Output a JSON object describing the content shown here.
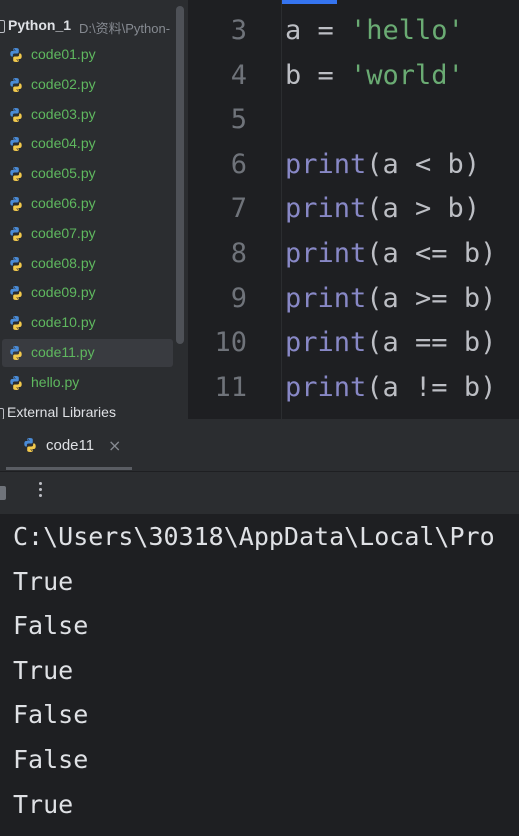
{
  "project": {
    "name": "Python_1",
    "path": "D:\\资料\\Python-",
    "files": [
      {
        "label": "code01.py"
      },
      {
        "label": "code02.py"
      },
      {
        "label": "code03.py"
      },
      {
        "label": "code04.py"
      },
      {
        "label": "code05.py"
      },
      {
        "label": "code06.py"
      },
      {
        "label": "code07.py"
      },
      {
        "label": "code08.py"
      },
      {
        "label": "code09.py"
      },
      {
        "label": "code10.py"
      },
      {
        "label": "code11.py",
        "selected": true
      },
      {
        "label": "hello.py"
      }
    ],
    "external_libraries": "External Libraries"
  },
  "editor": {
    "lines": [
      {
        "num": "3",
        "tokens": [
          [
            "a = ",
            ""
          ],
          [
            "'hello'",
            "str"
          ]
        ]
      },
      {
        "num": "4",
        "tokens": [
          [
            "b = ",
            ""
          ],
          [
            "'world'",
            "str"
          ]
        ]
      },
      {
        "num": "5",
        "tokens": []
      },
      {
        "num": "6",
        "tokens": [
          [
            "print",
            "kw"
          ],
          [
            "(a < b)",
            ""
          ]
        ]
      },
      {
        "num": "7",
        "tokens": [
          [
            "print",
            "kw"
          ],
          [
            "(a > b)",
            ""
          ]
        ]
      },
      {
        "num": "8",
        "tokens": [
          [
            "print",
            "kw"
          ],
          [
            "(a <= b)",
            ""
          ]
        ]
      },
      {
        "num": "9",
        "tokens": [
          [
            "print",
            "kw"
          ],
          [
            "(a >= b)",
            ""
          ]
        ]
      },
      {
        "num": "10",
        "tokens": [
          [
            "print",
            "kw"
          ],
          [
            "(a == b)",
            ""
          ]
        ]
      },
      {
        "num": "11",
        "tokens": [
          [
            "print",
            "kw"
          ],
          [
            "(a != b)",
            ""
          ]
        ]
      }
    ]
  },
  "run": {
    "tab_label": "code11",
    "close_glyph": "×",
    "more_icon": "more-vertical-icon",
    "console": [
      "C:\\Users\\30318\\AppData\\Local\\Pro",
      "True",
      "False",
      "True",
      "False",
      "False",
      "True"
    ]
  },
  "colors": {
    "file_label": "#5fb85f",
    "keyword": "#8888c6",
    "string": "#6aab73",
    "accent": "#3574f0"
  }
}
